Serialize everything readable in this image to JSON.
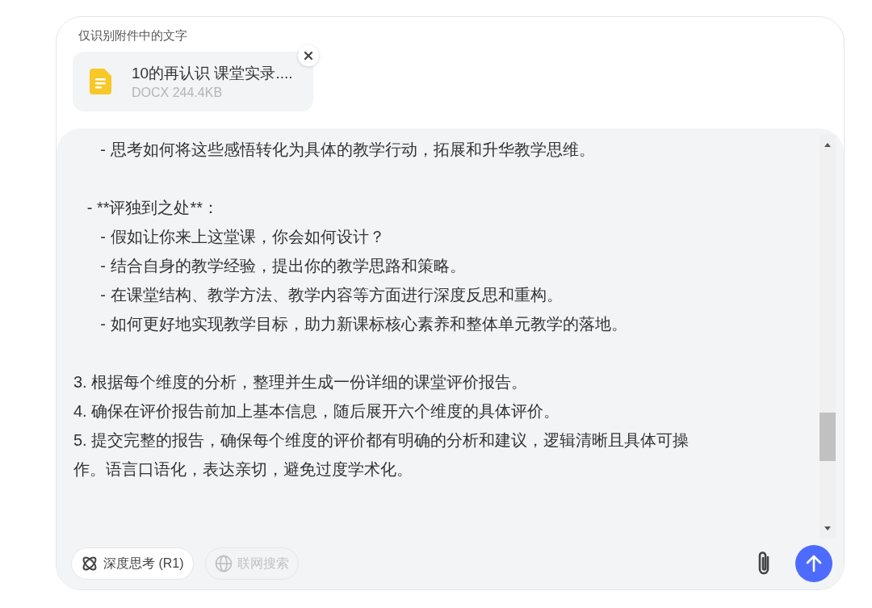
{
  "instruction": "仅识别附件中的文字",
  "attachment": {
    "name": "10的再认识 课堂实录....",
    "meta": "DOCX 244.4KB"
  },
  "input": {
    "value": "      - 思考如何将这些感悟转化为具体的教学行动，拓展和升华教学思维。\n\n   - **评独到之处**：\n      - 假如让你来上这堂课，你会如何设计？\n      - 结合自身的教学经验，提出你的教学思路和策略。\n      - 在课堂结构、教学方法、教学内容等方面进行深度反思和重构。\n      - 如何更好地实现教学目标，助力新课标核心素养和整体单元教学的落地。\n\n3. 根据每个维度的分析，整理并生成一份详细的课堂评价报告。\n4. 确保在评价报告前加上基本信息，随后展开六个维度的具体评价。\n5. 提交完整的报告，确保每个维度的评价都有明确的分析和建议，逻辑清晰且具体可操作。语言口语化，表达亲切，避免过度学术化。"
  },
  "toggles": [
    {
      "kind": "deep-think",
      "label": "深度思考 (R1)",
      "selected": true
    },
    {
      "kind": "web-search",
      "label": "联网搜索",
      "selected": false
    }
  ]
}
